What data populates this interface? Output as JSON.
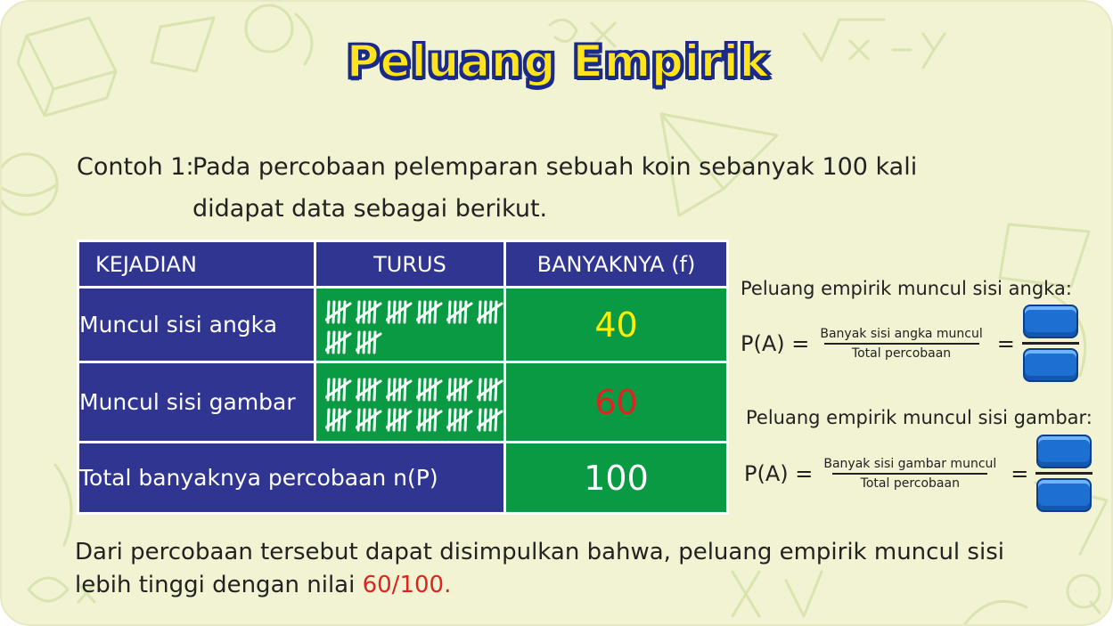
{
  "title": "Peluang Empirik",
  "intro": {
    "label": "Contoh 1:",
    "line1": "Pada percobaan pelemparan sebuah koin sebanyak 100 kali",
    "line2": "didapat data sebagai berikut."
  },
  "table": {
    "headers": [
      "KEJADIAN",
      "TURUS",
      "BANYAKNYA (f)"
    ],
    "rows": [
      {
        "label": "Muncul sisi angka",
        "value": "40",
        "tally_groups": 8
      },
      {
        "label": "Muncul sisi gambar",
        "value": "60",
        "tally_groups": 12
      }
    ],
    "total_label": "Total banyaknya percobaan n(P)",
    "total_value": "100"
  },
  "formulas": [
    {
      "heading": "Peluang empirik muncul sisi angka:",
      "lhs": "P(A) =",
      "numerator": "Banyak sisi angka muncul",
      "denominator": "Total percobaan",
      "equals": "="
    },
    {
      "heading": "Peluang empirik muncul sisi gambar:",
      "lhs": "P(A) =",
      "numerator": "Banyak sisi gambar muncul",
      "denominator": "Total percobaan",
      "equals": "="
    }
  ],
  "conclusion": {
    "line1": "Dari percobaan tersebut dapat disimpulkan bahwa, peluang empirik muncul sisi",
    "line2_prefix": "lebih tinggi dengan nilai ",
    "line2_value": "60/100."
  },
  "colors": {
    "background": "#f1f3d2",
    "header_blue": "#2f3591",
    "cell_green": "#0b9a44",
    "title_yellow": "#ffe41c",
    "highlight_red": "#e0231f",
    "value_yellow": "#ffee00",
    "answer_box_blue": "#1d6fd1"
  }
}
